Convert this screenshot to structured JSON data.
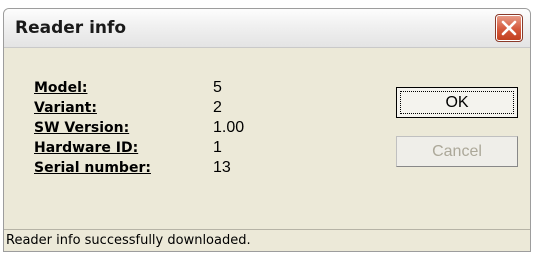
{
  "window": {
    "title": "Reader info"
  },
  "fields": [
    {
      "label": "Model:",
      "value": "5"
    },
    {
      "label": "Variant:",
      "value": "2"
    },
    {
      "label": "SW Version:",
      "value": "1.00"
    },
    {
      "label": "Hardware ID:",
      "value": "1"
    },
    {
      "label": "Serial number:",
      "value": "13"
    }
  ],
  "buttons": {
    "ok_label": "OK",
    "cancel_label": "Cancel",
    "cancel_enabled": false
  },
  "status": {
    "text": "Reader info successfully downloaded."
  },
  "icons": {
    "close": "close-icon"
  },
  "colors": {
    "dialog_face": "#ece9d8",
    "close_button": "#d5593c",
    "disabled_text": "#aca899"
  }
}
